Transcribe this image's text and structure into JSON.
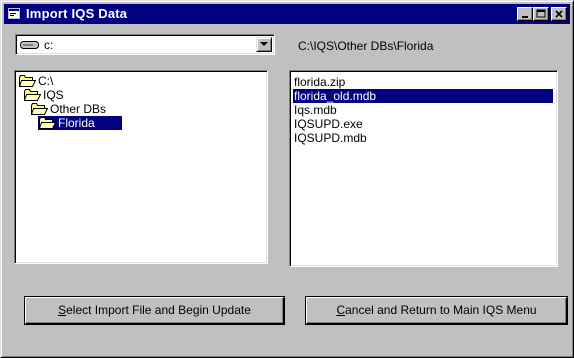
{
  "window": {
    "title": "Import IQS Data",
    "controls": {
      "minimize": "_",
      "maximize": "□",
      "close": "×"
    }
  },
  "drive_combo": {
    "value": "c:",
    "icon": "drive-icon"
  },
  "current_path": "C:\\IQS\\Other DBs\\Florida",
  "directory_list": [
    {
      "label": "C:\\",
      "icon": "open-folder-icon",
      "selected": false
    },
    {
      "label": "IQS",
      "icon": "open-folder-icon",
      "selected": false
    },
    {
      "label": "Other DBs",
      "icon": "open-folder-icon",
      "selected": false
    },
    {
      "label": "Florida",
      "icon": "open-folder-icon",
      "selected": true
    }
  ],
  "file_list": [
    {
      "label": "florida.zip",
      "selected": false
    },
    {
      "label": "florida_old.mdb",
      "selected": true
    },
    {
      "label": "Iqs.mdb",
      "selected": false
    },
    {
      "label": "IQSUPD.exe",
      "selected": false
    },
    {
      "label": "IQSUPD.mdb",
      "selected": false
    }
  ],
  "buttons": {
    "import": {
      "mnemonic": "S",
      "rest": "elect Import File and Begin Update"
    },
    "cancel": {
      "mnemonic": "C",
      "rest": "ancel and Return to Main IQS Menu"
    }
  },
  "colors": {
    "title_bar": "#000080",
    "selection": "#000080",
    "face": "#c0c0c0",
    "folder": "#ffff80"
  }
}
